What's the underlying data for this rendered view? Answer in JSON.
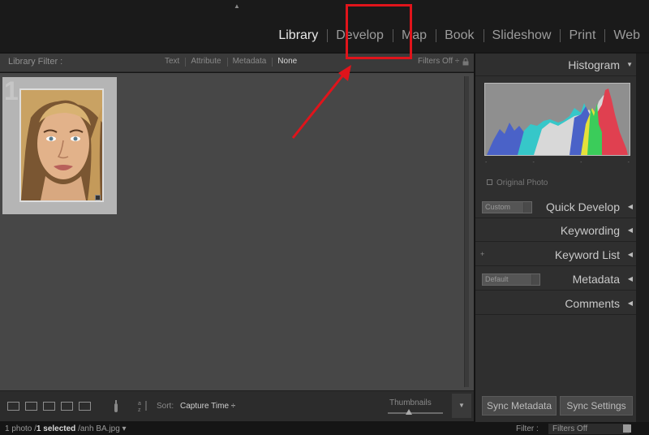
{
  "modules": [
    "Library",
    "Develop",
    "Map",
    "Book",
    "Slideshow",
    "Print",
    "Web"
  ],
  "active_module": "Library",
  "highlighted_module": "Develop",
  "colors": {
    "annotation": "#e0141b",
    "panel_bg": "#2f2f2f",
    "grid_bg": "#474747"
  },
  "library_filter": {
    "title": "Library Filter :",
    "tabs": [
      "Text",
      "Attribute",
      "Metadata",
      "None"
    ],
    "active_tab": "None",
    "filters_off": "Filters Off ÷"
  },
  "grid": {
    "cell_index": "1"
  },
  "toolbar": {
    "sort_label": "Sort:",
    "sort_value": "Capture Time ÷",
    "thumbnails_label": "Thumbnails"
  },
  "right_panel": {
    "histogram": "Histogram",
    "original_photo": "Original Photo",
    "quick_develop": "Quick Develop",
    "quick_develop_preset": "Custom",
    "keywording": "Keywording",
    "keyword_list": "Keyword List",
    "metadata": "Metadata",
    "metadata_preset": "Default",
    "comments": "Comments",
    "sync_metadata": "Sync Metadata",
    "sync_settings": "Sync Settings"
  },
  "status": {
    "count": "1 photo /",
    "selected": "1 selected",
    "filename": "/anh BA.jpg ▾",
    "filter_label": "Filter :",
    "filter_value": "Filters Off"
  }
}
